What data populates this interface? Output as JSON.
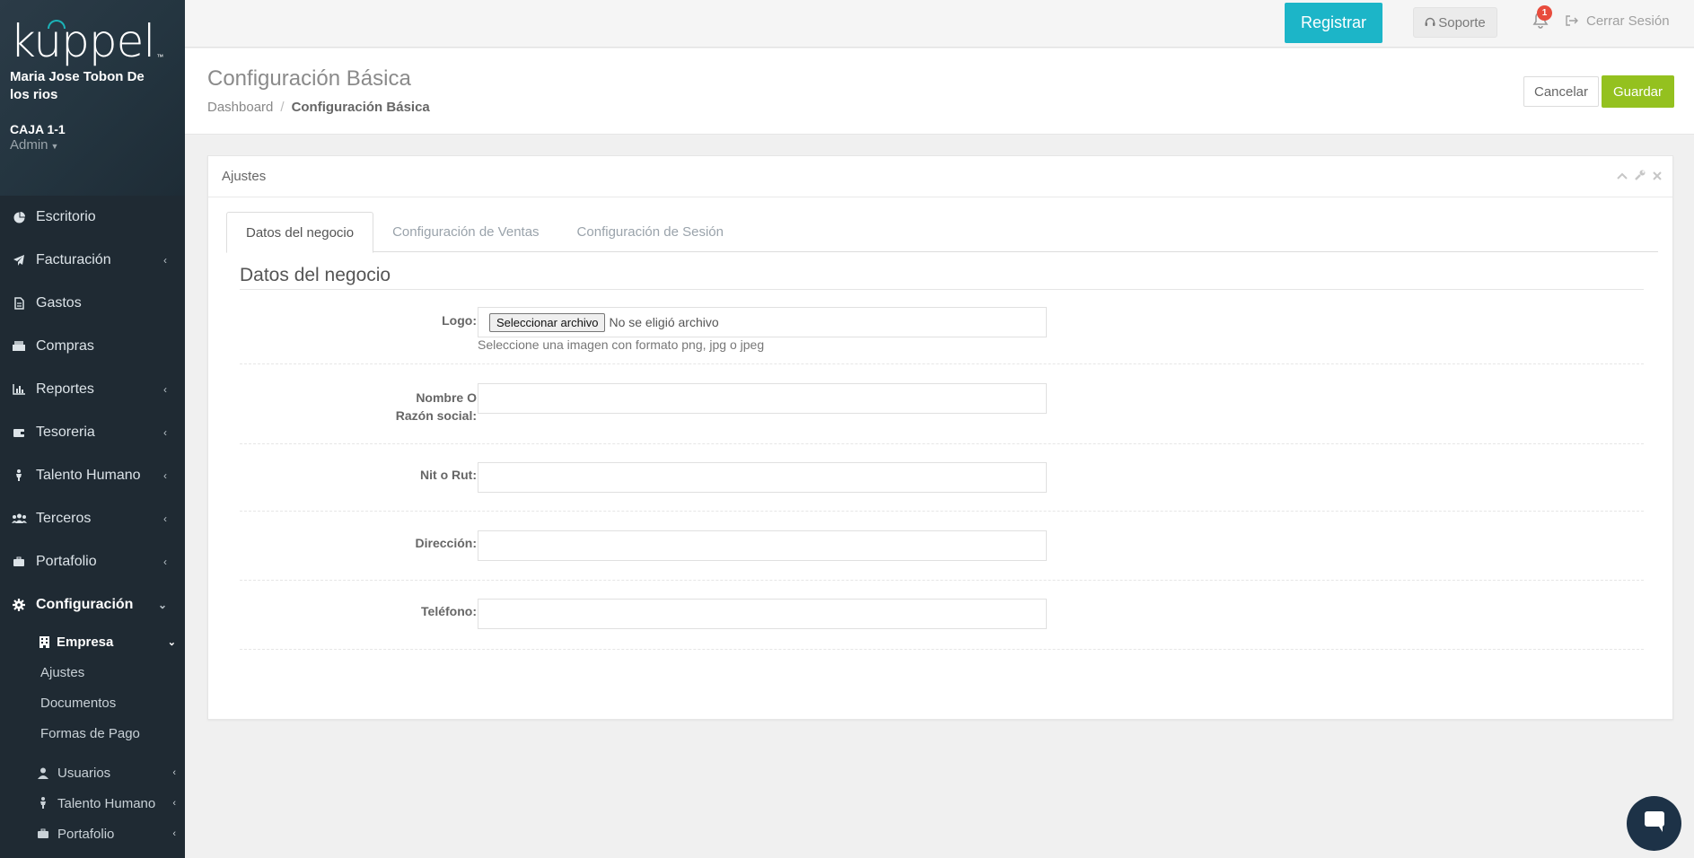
{
  "sidebar": {
    "logo": "kuppel",
    "user_name": "Maria Jose Tobon De los rios",
    "caja": "CAJA 1-1",
    "role": "Admin",
    "items": [
      {
        "label": "Escritorio",
        "icon": "pie-chart-icon"
      },
      {
        "label": "Facturación",
        "icon": "paper-plane-icon"
      },
      {
        "label": "Gastos",
        "icon": "file-icon"
      },
      {
        "label": "Compras",
        "icon": "boxes-icon"
      },
      {
        "label": "Reportes",
        "icon": "bar-chart-icon"
      },
      {
        "label": "Tesoreria",
        "icon": "wallet-icon"
      },
      {
        "label": "Talento Humano",
        "icon": "person-icon"
      },
      {
        "label": "Terceros",
        "icon": "users-icon"
      },
      {
        "label": "Portafolio",
        "icon": "briefcase-icon"
      },
      {
        "label": "Configuración",
        "icon": "gear-icon"
      }
    ],
    "empresa": {
      "label": "Empresa",
      "items": [
        "Ajustes",
        "Documentos",
        "Formas de Pago"
      ]
    },
    "extra": [
      {
        "label": "Usuarios",
        "icon": "user-icon"
      },
      {
        "label": "Talento Humano",
        "icon": "person-icon"
      },
      {
        "label": "Portafolio",
        "icon": "briefcase-icon"
      }
    ]
  },
  "topbar": {
    "registrar": "Registrar",
    "soporte": "Soporte",
    "notifications": "1",
    "logout": "Cerrar Sesión"
  },
  "header": {
    "title": "Configuración Básica",
    "breadcrumb": [
      "Dashboard",
      "Configuración Básica"
    ],
    "cancel": "Cancelar",
    "save": "Guardar"
  },
  "panel": {
    "title": "Ajustes",
    "tabs": [
      "Datos del negocio",
      "Configuración de Ventas",
      "Configuración de Sesión"
    ],
    "section_title": "Datos del negocio",
    "fields": {
      "logo_label": "Logo:",
      "file_button": "Seleccionar archivo",
      "file_status": "No se eligió archivo",
      "logo_help": "Seleccione una imagen con formato png, jpg o jpeg",
      "nombre_label_1": "Nombre O",
      "nombre_label_2": "Razón social:",
      "nit_label": "Nit o Rut:",
      "direccion_label": "Dirección:",
      "telefono_label": "Teléfono:"
    }
  },
  "colors": {
    "sidebar_bg": "#1f2a33",
    "registrar": "#1cb5c8",
    "save": "#94c11f",
    "badge": "#e84c3d",
    "chat": "#1d3247"
  }
}
